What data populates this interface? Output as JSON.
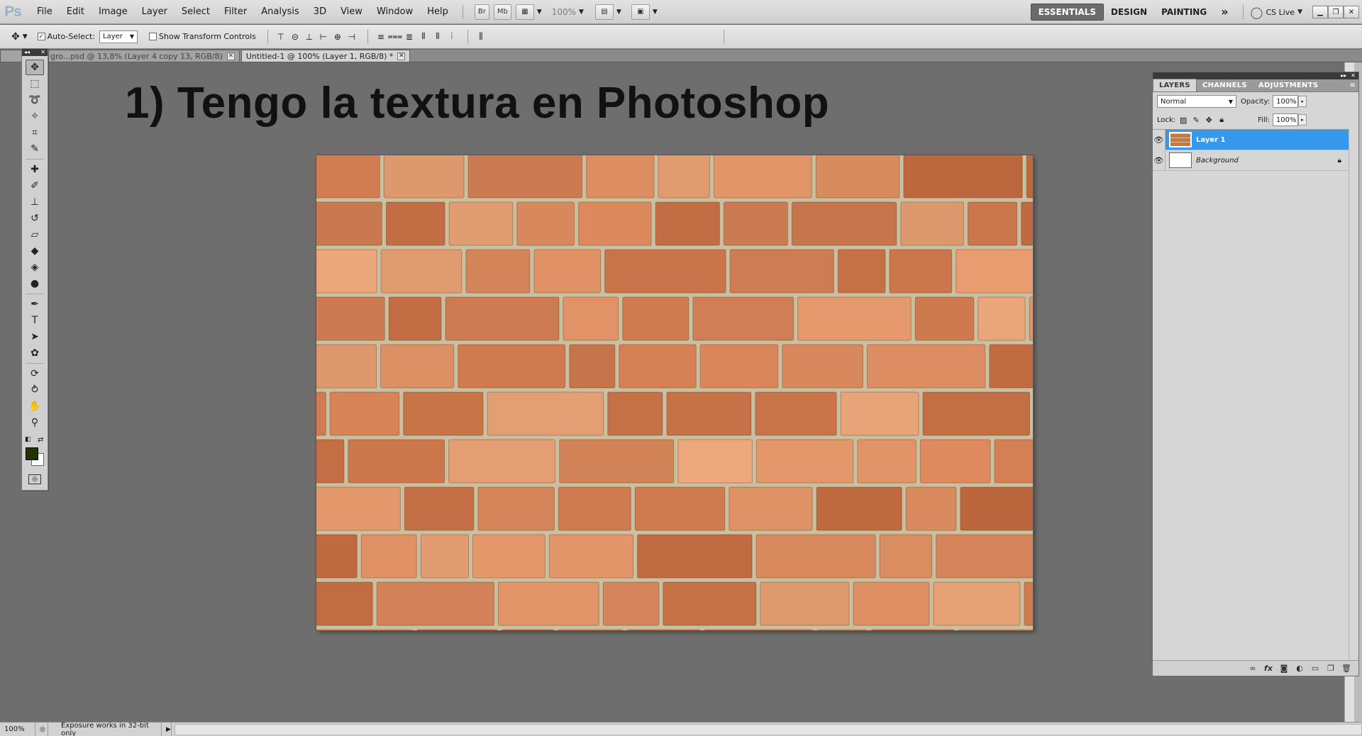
{
  "app": {
    "logo": "Ps"
  },
  "menubar": {
    "items": [
      "File",
      "Edit",
      "Image",
      "Layer",
      "Select",
      "Filter",
      "Analysis",
      "3D",
      "View",
      "Window",
      "Help"
    ],
    "bridge_button": "Br",
    "minibridge_button": "Mb",
    "zoom": "100%",
    "workspaces": [
      "ESSENTIALS",
      "DESIGN",
      "PAINTING"
    ],
    "active_workspace": "ESSENTIALS",
    "more": "»",
    "cs_live": "CS Live"
  },
  "options": {
    "auto_select_label": "Auto-Select:",
    "auto_select_checked": true,
    "auto_select_value": "Layer",
    "show_transform_label": "Show Transform Controls",
    "show_transform_checked": false
  },
  "tabs": [
    {
      "label": "gro...psd @ 13,8% (Layer 4 copy 13, RGB/8)",
      "active": false
    },
    {
      "label": "Untitled-1 @ 100% (Layer 1, RGB/8) *",
      "active": true
    }
  ],
  "canvas": {
    "title": "1) Tengo la textura en Photoshop"
  },
  "tools": {
    "fg_color": "#253300",
    "bg_color": "#ffffff"
  },
  "layers_panel": {
    "tabs": [
      "LAYERS",
      "CHANNELS",
      "ADJUSTMENTS"
    ],
    "active_tab": "LAYERS",
    "blend_mode": "Normal",
    "opacity_label": "Opacity:",
    "opacity": "100%",
    "lock_label": "Lock:",
    "fill_label": "Fill:",
    "fill": "100%",
    "layers": [
      {
        "name": "Layer 1",
        "selected": true,
        "visible": true,
        "locked": false
      },
      {
        "name": "Background",
        "selected": false,
        "visible": true,
        "locked": true
      }
    ]
  },
  "statusbar": {
    "zoom": "100%",
    "info": "Exposure works in 32-bit only"
  },
  "colors": {
    "selection": "#3598ea",
    "brick": "#d98a5a",
    "mortar": "#cbbf9f"
  }
}
